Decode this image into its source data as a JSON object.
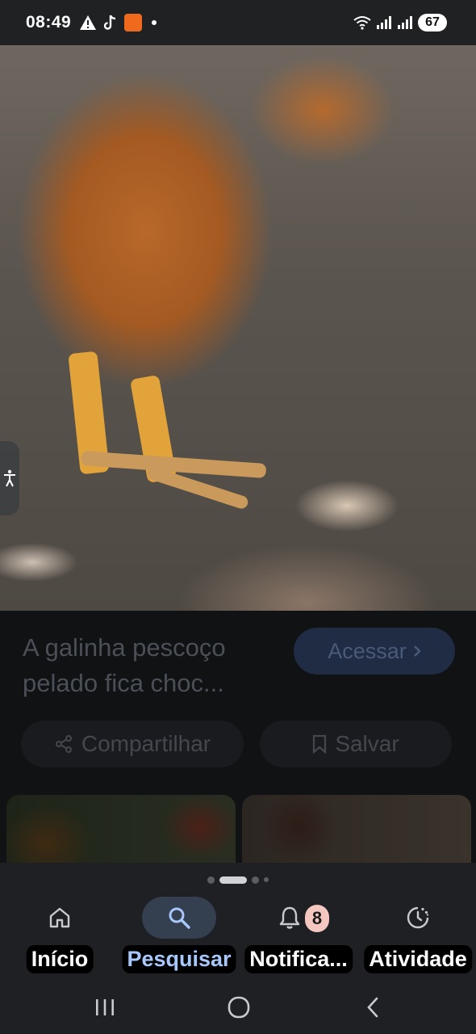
{
  "status_bar": {
    "time": "08:49",
    "battery": "67"
  },
  "result": {
    "title": "A galinha pescoço pelado fica choc...",
    "open_label": "Acessar",
    "share_label": "Compartilhar",
    "save_label": "Salvar"
  },
  "bottom_nav": {
    "items": [
      {
        "label": "Início",
        "icon": "home-icon"
      },
      {
        "label": "Pesquisar",
        "icon": "search-icon",
        "active": true
      },
      {
        "label": "Notifica...",
        "icon": "bell-icon",
        "badge": "8"
      },
      {
        "label": "Atividade",
        "icon": "activity-icon"
      }
    ]
  },
  "colors": {
    "accent": "#a8c7fa",
    "active_pill": "#34404f",
    "background": "#111214"
  }
}
